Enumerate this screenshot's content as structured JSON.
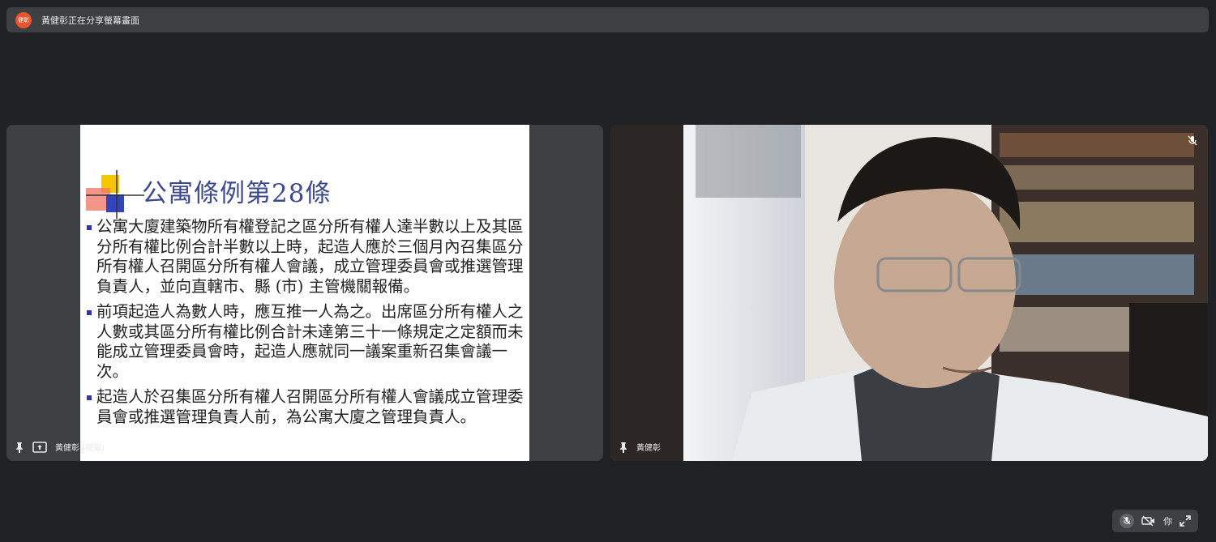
{
  "banner": {
    "avatar_text": "健彰",
    "text": "黃健彰正在分享螢幕畫面"
  },
  "slide": {
    "title": "公寓條例第28條",
    "paragraphs": [
      "公寓大廈建築物所有權登記之區分所有權人達半數以上及其區分所有權比例合計半數以上時，起造人應於三個月內召集區分所有權人召開區分所有權人會議，成立管理委員會或推選管理負責人，並向直轄市、縣 (市) 主管機關報備。",
      "前項起造人為數人時，應互推一人為之。出席區分所有權人之人數或其區分所有權比例合計未達第三十一條規定之定額而未能成立管理委員會時，起造人應就同一議案重新召集會議一次。",
      "起造人於召集區分所有權人召開區分所有權人會議成立管理委員會或推選管理負責人前，為公寓大廈之管理負責人。"
    ]
  },
  "left_tile": {
    "label": "黃健彰 (簡報)"
  },
  "right_tile": {
    "label": "黃健彰"
  },
  "self_pill": {
    "label": "你"
  },
  "colors": {
    "background": "#202124",
    "tile": "#3c4043",
    "title": "#3d4a8f",
    "accent": "#e8542b"
  }
}
